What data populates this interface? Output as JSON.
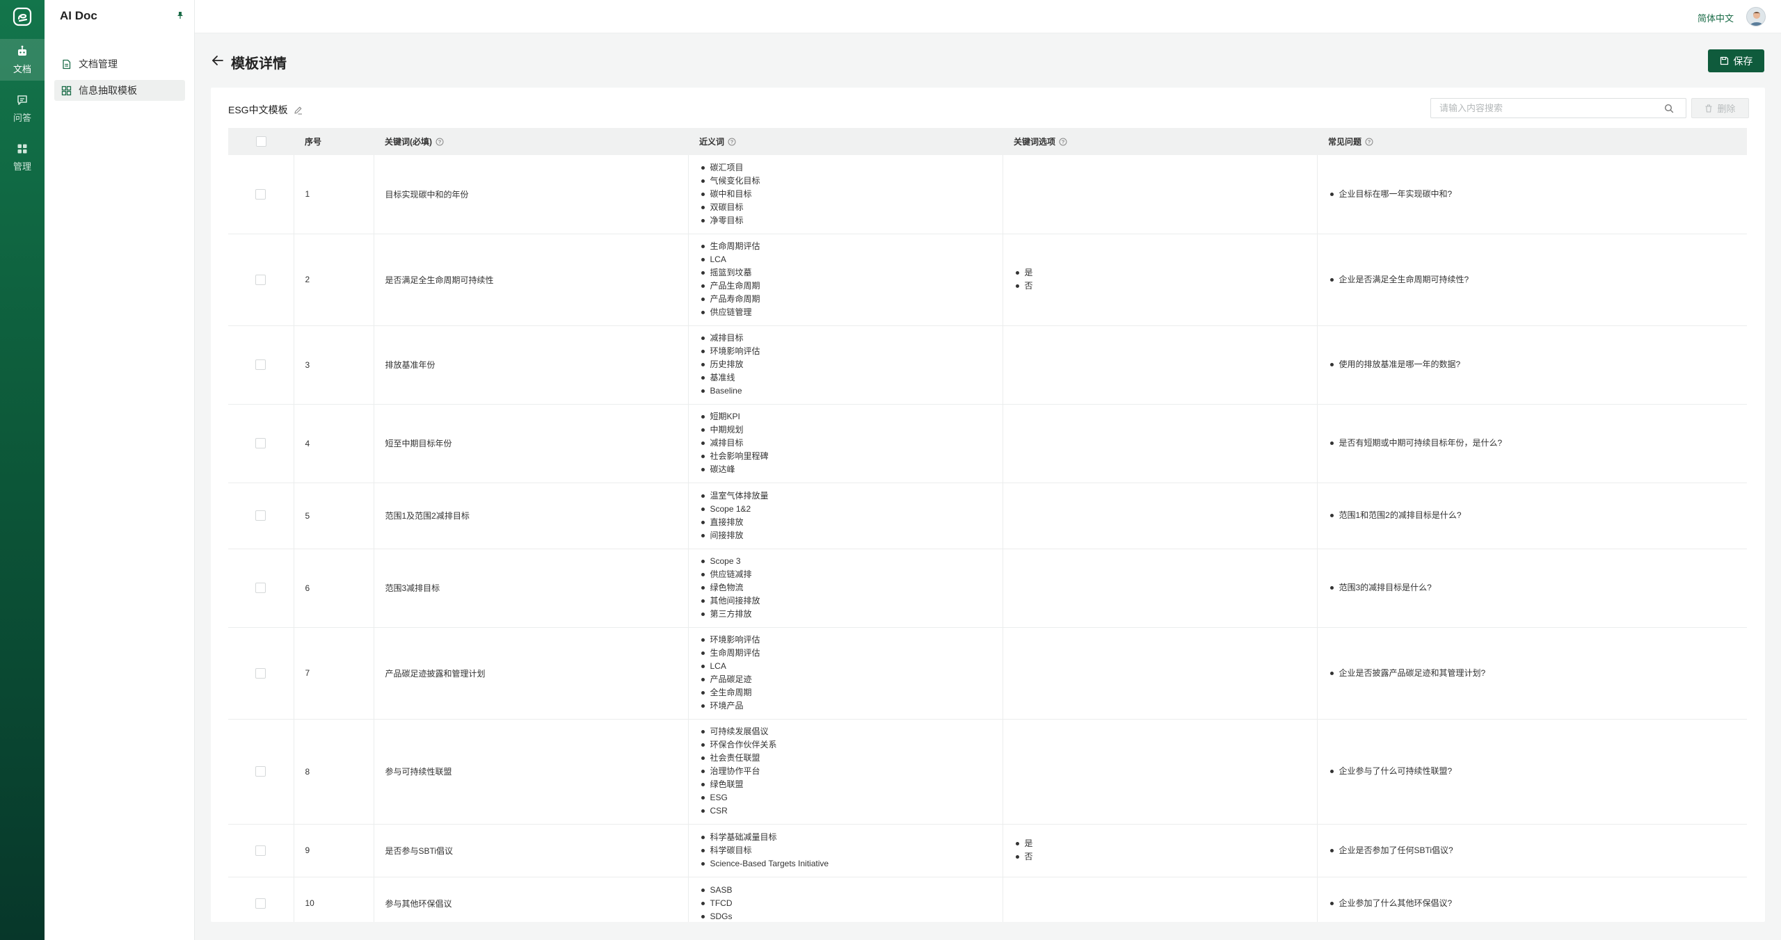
{
  "app": {
    "title": "AI Doc"
  },
  "rail": {
    "items": [
      {
        "label": "文档",
        "icon": "robot-icon",
        "active": true
      },
      {
        "label": "问答",
        "icon": "chat-icon",
        "active": false
      },
      {
        "label": "管理",
        "icon": "grid-icon",
        "active": false
      }
    ]
  },
  "side_menu": {
    "items": [
      {
        "label": "文档管理",
        "icon": "document-icon",
        "active": false
      },
      {
        "label": "信息抽取模板",
        "icon": "template-grid-icon",
        "active": true
      }
    ]
  },
  "topbar": {
    "language": "简体中文"
  },
  "page": {
    "title": "模板详情",
    "save_label": "保存"
  },
  "template": {
    "name": "ESG中文模板"
  },
  "search": {
    "placeholder": "请输入内容搜索",
    "value": ""
  },
  "delete_label": "删除",
  "columns": {
    "index": "序号",
    "keyword": "关键词(必填)",
    "synonyms": "近义词",
    "options": "关键词选项",
    "faq": "常见问题"
  },
  "rows": [
    {
      "index": "1",
      "keyword": "目标实现碳中和的年份",
      "synonyms": [
        "碳汇项目",
        "气候变化目标",
        "碳中和目标",
        "双碳目标",
        "净零目标"
      ],
      "options": [],
      "faq": [
        "企业目标在哪一年实现碳中和?"
      ]
    },
    {
      "index": "2",
      "keyword": "是否满足全生命周期可持续性",
      "synonyms": [
        "生命周期评估",
        "LCA",
        "摇篮到坟墓",
        "产品生命周期",
        "产品寿命周期",
        "供应链管理"
      ],
      "options": [
        "是",
        "否"
      ],
      "faq": [
        "企业是否满足全生命周期可持续性?"
      ]
    },
    {
      "index": "3",
      "keyword": "排放基准年份",
      "synonyms": [
        "减排目标",
        "环境影响评估",
        "历史排放",
        "基准线",
        "Baseline"
      ],
      "options": [],
      "faq": [
        "使用的排放基准是哪一年的数据?"
      ]
    },
    {
      "index": "4",
      "keyword": "短至中期目标年份",
      "synonyms": [
        "短期KPI",
        "中期规划",
        "减排目标",
        "社会影响里程碑",
        "碳达峰"
      ],
      "options": [],
      "faq": [
        "是否有短期或中期可持续目标年份，是什么?"
      ]
    },
    {
      "index": "5",
      "keyword": "范围1及范围2减排目标",
      "synonyms": [
        "温室气体排放量",
        "Scope 1&2",
        "直接排放",
        "间接排放"
      ],
      "options": [],
      "faq": [
        "范围1和范围2的减排目标是什么?"
      ]
    },
    {
      "index": "6",
      "keyword": "范围3减排目标",
      "synonyms": [
        "Scope 3",
        "供应链减排",
        "绿色物流",
        "其他间接排放",
        "第三方排放"
      ],
      "options": [],
      "faq": [
        "范围3的减排目标是什么?"
      ]
    },
    {
      "index": "7",
      "keyword": "产品碳足迹披露和管理计划",
      "synonyms": [
        "环境影响评估",
        "生命周期评估",
        "LCA",
        "产品碳足迹",
        "全生命周期",
        "环境产品"
      ],
      "options": [],
      "faq": [
        "企业是否披露产品碳足迹和其管理计划?"
      ]
    },
    {
      "index": "8",
      "keyword": "参与可持续性联盟",
      "synonyms": [
        "可持续发展倡议",
        "环保合作伙伴关系",
        "社会责任联盟",
        "治理协作平台",
        "绿色联盟",
        "ESG",
        "CSR"
      ],
      "options": [],
      "faq": [
        "企业参与了什么可持续性联盟?"
      ]
    },
    {
      "index": "9",
      "keyword": "是否参与SBTi倡议",
      "synonyms": [
        "科学基础减量目标",
        "科学碳目标",
        "Science-Based Targets Initiative"
      ],
      "options": [
        "是",
        "否"
      ],
      "faq": [
        "企业是否参加了任何SBTi倡议?"
      ]
    },
    {
      "index": "10",
      "keyword": "参与其他环保倡议",
      "synonyms": [
        "SASB",
        "TFCD",
        "SDGs"
      ],
      "options": [],
      "faq": [
        "企业参加了什么其他环保倡议?"
      ]
    }
  ],
  "colors": {
    "brand": "#0f5b3c",
    "rail_top": "#13754b",
    "rail_bottom": "#07372a"
  }
}
